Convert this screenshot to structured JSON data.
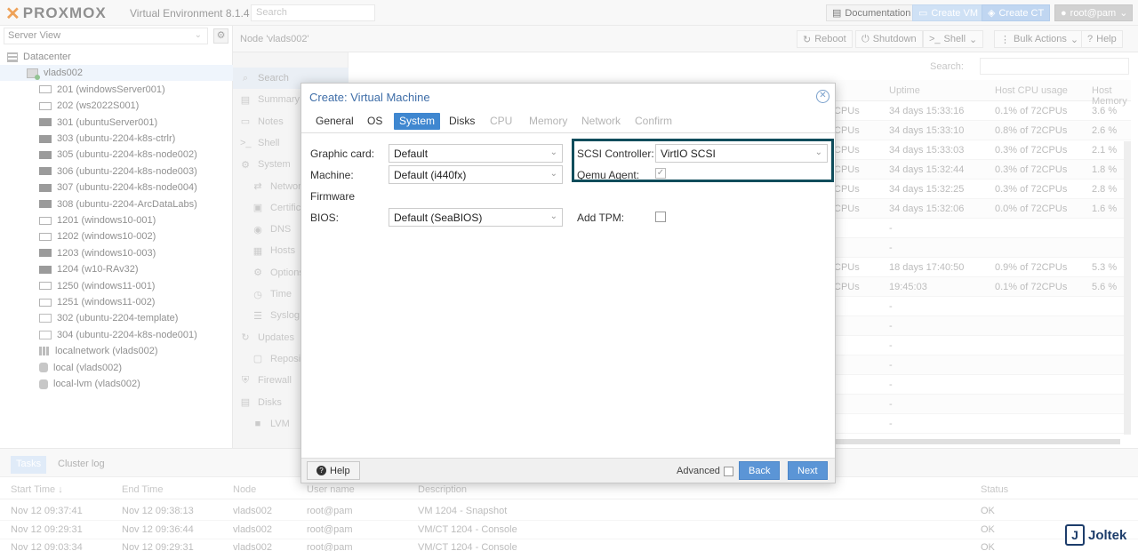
{
  "header": {
    "logo": "PROXMOX",
    "version": "Virtual Environment 8.1.4",
    "search_placeholder": "Search",
    "documentation": "Documentation",
    "create_vm": "Create VM",
    "create_ct": "Create CT",
    "user": "root@pam"
  },
  "tree": {
    "view": "Server View",
    "items": [
      {
        "label": "Datacenter"
      },
      {
        "label": "vlads002"
      },
      {
        "label": "201 (windowsServer001)"
      },
      {
        "label": "202 (ws2022S001)"
      },
      {
        "label": "301 (ubuntuServer001)"
      },
      {
        "label": "303 (ubuntu-2204-k8s-ctrlr)"
      },
      {
        "label": "305 (ubuntu-2204-k8s-node002)"
      },
      {
        "label": "306 (ubuntu-2204-k8s-node003)"
      },
      {
        "label": "307 (ubuntu-2204-k8s-node004)"
      },
      {
        "label": "308 (ubuntu-2204-ArcDataLabs)"
      },
      {
        "label": "1201 (windows10-001)"
      },
      {
        "label": "1202 (windows10-002)"
      },
      {
        "label": "1203 (windows10-003)"
      },
      {
        "label": "1204 (w10-RAv32)"
      },
      {
        "label": "1250 (windows11-001)"
      },
      {
        "label": "1251 (windows11-002)"
      },
      {
        "label": "302 (ubuntu-2204-template)"
      },
      {
        "label": "304 (ubuntu-2204-k8s-node001)"
      },
      {
        "label": "localnetwork (vlads002)"
      },
      {
        "label": "local (vlads002)"
      },
      {
        "label": "local-lvm (vlads002)"
      }
    ]
  },
  "main": {
    "node_title": "Node 'vlads002'",
    "reboot": "Reboot",
    "shutdown": "Shutdown",
    "shell": "Shell",
    "bulk_actions": "Bulk Actions",
    "help": "Help",
    "search_label": "Search:",
    "nav": [
      {
        "label": "Search"
      },
      {
        "label": "Summary"
      },
      {
        "label": "Notes"
      },
      {
        "label": "Shell"
      },
      {
        "label": "System"
      },
      {
        "label": "Network"
      },
      {
        "label": "Certificates"
      },
      {
        "label": "DNS"
      },
      {
        "label": "Hosts"
      },
      {
        "label": "Options"
      },
      {
        "label": "Time"
      },
      {
        "label": "Syslog"
      },
      {
        "label": "Updates"
      },
      {
        "label": "Repositories"
      },
      {
        "label": "Firewall"
      },
      {
        "label": "Disks"
      },
      {
        "label": "LVM"
      }
    ],
    "columns": {
      "cpu": "",
      "uptime": "Uptime",
      "host_cpu": "Host CPU usage",
      "host_mem": "Host Memory"
    },
    "rows": [
      {
        "cpu": "CPUs",
        "uptime": "34 days 15:33:16",
        "host_cpu": "0.1% of 72CPUs",
        "host_mem": "3.6 %"
      },
      {
        "cpu": "CPUs",
        "uptime": "34 days 15:33:10",
        "host_cpu": "0.8% of 72CPUs",
        "host_mem": "2.6 %"
      },
      {
        "cpu": "CPUs",
        "uptime": "34 days 15:33:03",
        "host_cpu": "0.3% of 72CPUs",
        "host_mem": "2.1 %"
      },
      {
        "cpu": "CPUs",
        "uptime": "34 days 15:32:44",
        "host_cpu": "0.3% of 72CPUs",
        "host_mem": "1.8 %"
      },
      {
        "cpu": "CPUs",
        "uptime": "34 days 15:32:25",
        "host_cpu": "0.3% of 72CPUs",
        "host_mem": "2.8 %"
      },
      {
        "cpu": "CPUs",
        "uptime": "34 days 15:32:06",
        "host_cpu": "0.0% of 72CPUs",
        "host_mem": "1.6 %"
      },
      {
        "cpu": "",
        "uptime": "-",
        "host_cpu": "",
        "host_mem": ""
      },
      {
        "cpu": "",
        "uptime": "-",
        "host_cpu": "",
        "host_mem": ""
      },
      {
        "cpu": "CPUs",
        "uptime": "18 days 17:40:50",
        "host_cpu": "0.9% of 72CPUs",
        "host_mem": "5.3 %"
      },
      {
        "cpu": "CPUs",
        "uptime": "19:45:03",
        "host_cpu": "0.1% of 72CPUs",
        "host_mem": "5.6 %"
      },
      {
        "cpu": "",
        "uptime": "-",
        "host_cpu": "",
        "host_mem": ""
      },
      {
        "cpu": "",
        "uptime": "-",
        "host_cpu": "",
        "host_mem": ""
      },
      {
        "cpu": "",
        "uptime": "-",
        "host_cpu": "",
        "host_mem": ""
      },
      {
        "cpu": "",
        "uptime": "-",
        "host_cpu": "",
        "host_mem": ""
      },
      {
        "cpu": "",
        "uptime": "-",
        "host_cpu": "",
        "host_mem": ""
      },
      {
        "cpu": "",
        "uptime": "-",
        "host_cpu": "",
        "host_mem": ""
      },
      {
        "cpu": "",
        "uptime": "-",
        "host_cpu": "",
        "host_mem": ""
      }
    ]
  },
  "bottom": {
    "tabs": [
      "Tasks",
      "Cluster log"
    ],
    "columns": [
      "Start Time",
      "End Time",
      "Node",
      "User name",
      "Description",
      "Status"
    ],
    "rows": [
      {
        "start": "Nov 12 09:37:41",
        "end": "Nov 12 09:38:13",
        "node": "vlads002",
        "user": "root@pam",
        "desc": "VM 1204 - Snapshot",
        "status": "OK"
      },
      {
        "start": "Nov 12 09:29:31",
        "end": "Nov 12 09:36:44",
        "node": "vlads002",
        "user": "root@pam",
        "desc": "VM/CT 1204 - Console",
        "status": "OK"
      },
      {
        "start": "Nov 12 09:03:34",
        "end": "Nov 12 09:29:31",
        "node": "vlads002",
        "user": "root@pam",
        "desc": "VM/CT 1204 - Console",
        "status": "OK"
      }
    ]
  },
  "dialog": {
    "title": "Create: Virtual Machine",
    "tabs": [
      {
        "label": "General",
        "state": "normal"
      },
      {
        "label": "OS",
        "state": "normal"
      },
      {
        "label": "System",
        "state": "selected"
      },
      {
        "label": "Disks",
        "state": "normal"
      },
      {
        "label": "CPU",
        "state": "disabled"
      },
      {
        "label": "Memory",
        "state": "disabled"
      },
      {
        "label": "Network",
        "state": "disabled"
      },
      {
        "label": "Confirm",
        "state": "disabled"
      }
    ],
    "graphic_card_label": "Graphic card:",
    "graphic_card_value": "Default",
    "machine_label": "Machine:",
    "machine_value": "Default (i440fx)",
    "firmware_label": "Firmware",
    "bios_label": "BIOS:",
    "bios_value": "Default (SeaBIOS)",
    "scsi_label": "SCSI Controller:",
    "scsi_value": "VirtIO SCSI",
    "qemu_label": "Qemu Agent:",
    "qemu_checked": true,
    "tpm_label": "Add TPM:",
    "tpm_checked": false,
    "help": "Help",
    "advanced": "Advanced",
    "back": "Back",
    "next": "Next",
    "highlight_color": "#0f4d5c"
  },
  "watermark": {
    "letter": "J",
    "text": "Joltek"
  }
}
